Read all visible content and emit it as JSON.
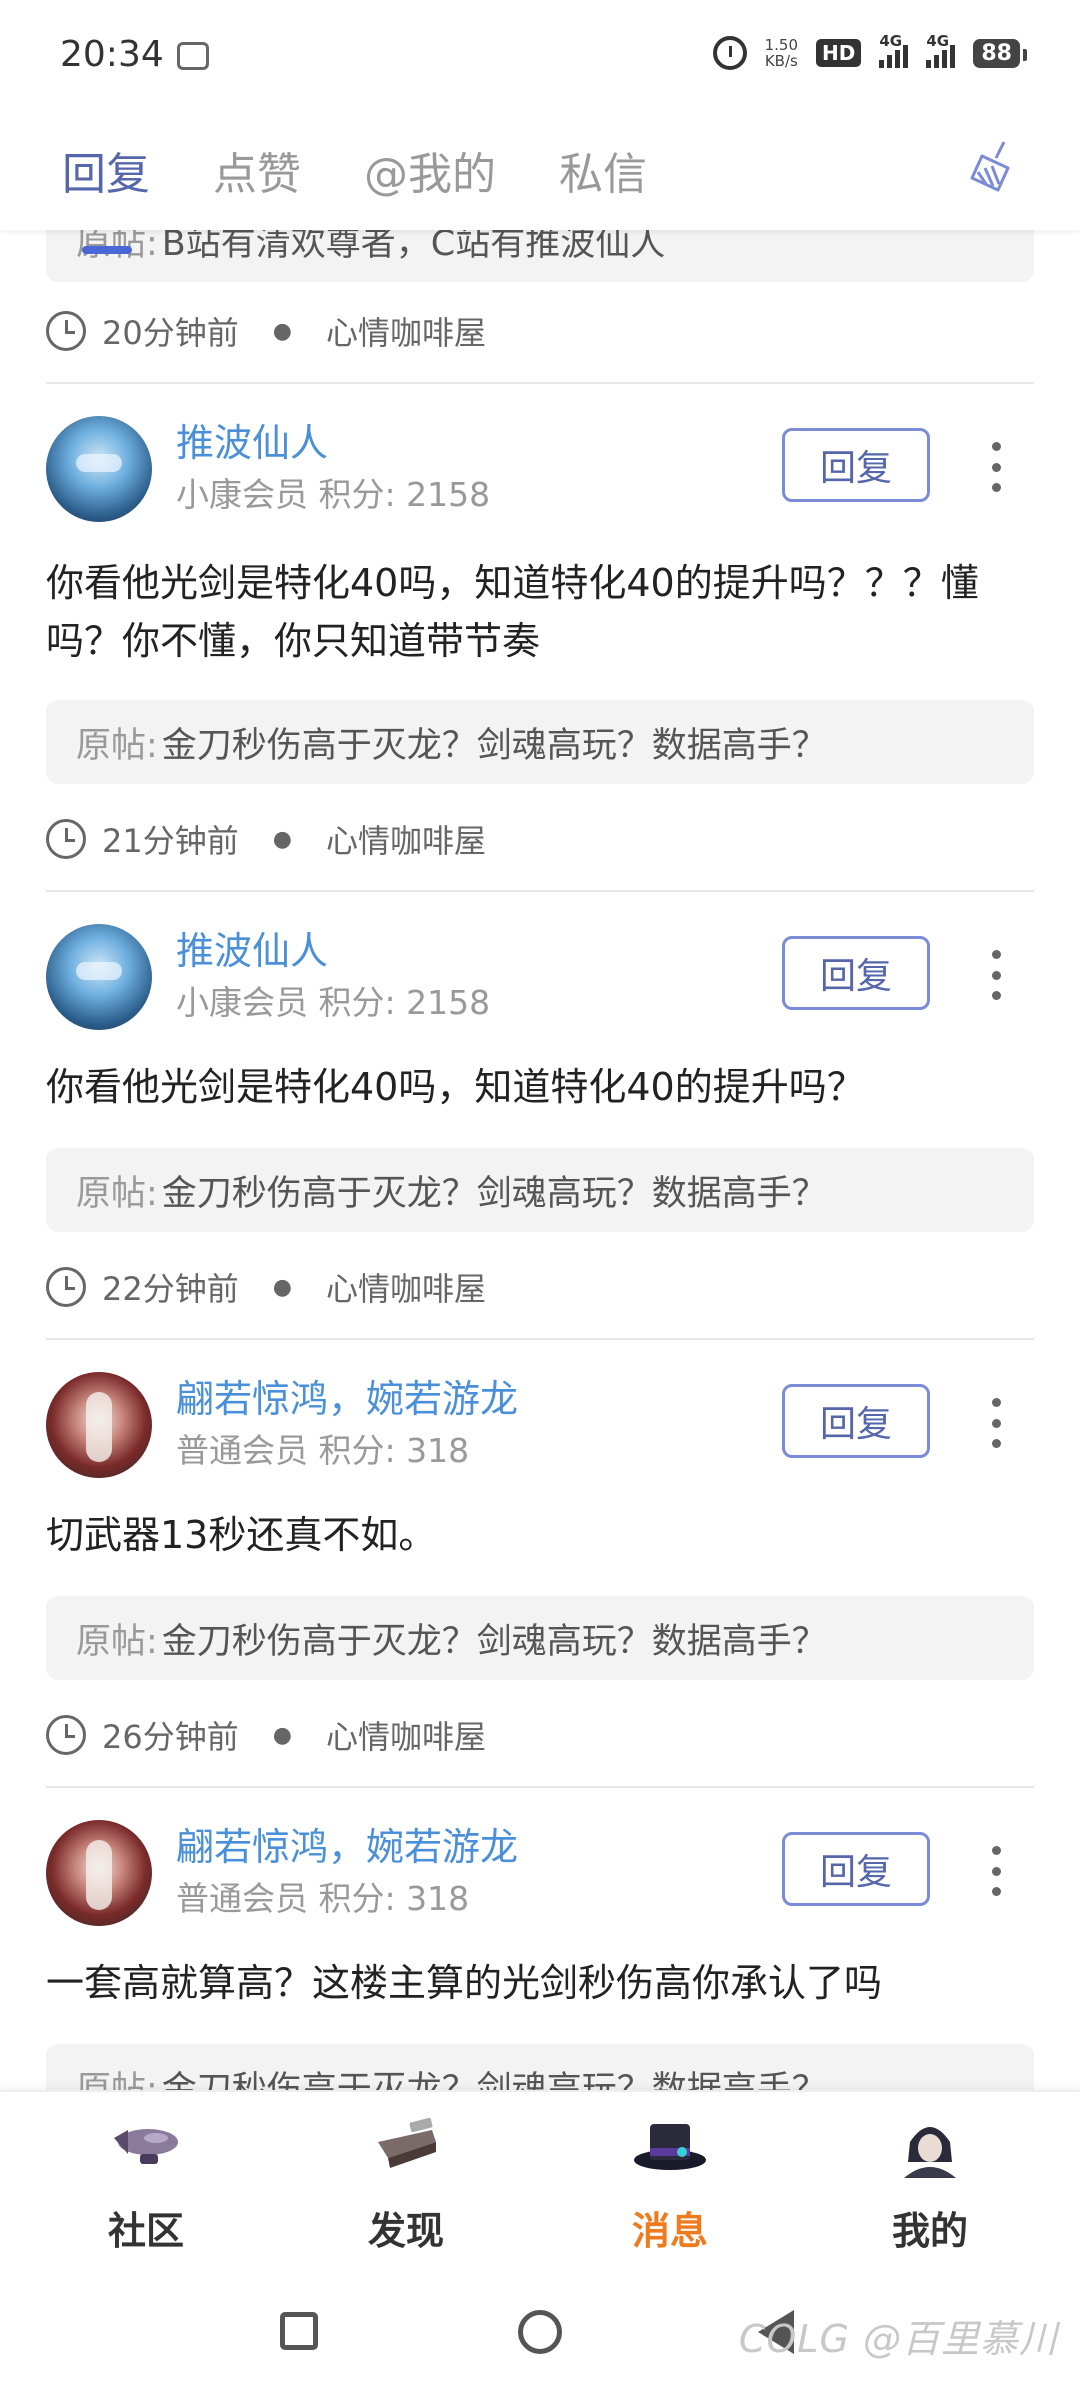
{
  "status_bar": {
    "time": "20:34",
    "net_speed_value": "1.50",
    "net_speed_unit": "KB/s",
    "hd": "HD",
    "signal1": "4G",
    "signal2": "4G",
    "battery": "88"
  },
  "tabs": [
    {
      "label": "回复",
      "active": true
    },
    {
      "label": "点赞",
      "active": false
    },
    {
      "label": "@我的",
      "active": false
    },
    {
      "label": "私信",
      "active": false
    }
  ],
  "feed": {
    "top_partial": {
      "quote_label": "原帖:",
      "quote_text": "B站有清欢尊者，C站有推波仙人",
      "time": "20分钟前",
      "board": "心情咖啡屋"
    },
    "items": [
      {
        "username": "推波仙人",
        "member": "小康会员",
        "score": "积分: 2158",
        "reply_label": "回复",
        "content": "你看他光剑是特化40吗，知道特化40的提升吗？？？懂吗？你不懂，你只知道带节奏",
        "quote_label": "原帖:",
        "quote_text": "金刀秒伤高于灭龙？剑魂高玩？数据高手？",
        "time": "21分钟前",
        "board": "心情咖啡屋"
      },
      {
        "username": "推波仙人",
        "member": "小康会员",
        "score": "积分: 2158",
        "reply_label": "回复",
        "content": "你看他光剑是特化40吗，知道特化40的提升吗？",
        "quote_label": "原帖:",
        "quote_text": "金刀秒伤高于灭龙？剑魂高玩？数据高手？",
        "time": "22分钟前",
        "board": "心情咖啡屋"
      },
      {
        "username": "翩若惊鸿，婉若游龙",
        "member": "普通会员",
        "score": "积分: 318",
        "reply_label": "回复",
        "content": "切武器13秒还真不如。",
        "quote_label": "原帖:",
        "quote_text": "金刀秒伤高于灭龙？剑魂高玩？数据高手？",
        "time": "26分钟前",
        "board": "心情咖啡屋"
      },
      {
        "username": "翩若惊鸿，婉若游龙",
        "member": "普通会员",
        "score": "积分: 318",
        "reply_label": "回复",
        "content": "一套高就算高？这楼主算的光剑秒伤高你承认了吗",
        "quote_label": "原帖:",
        "quote_text": "金刀秒伤高于灭龙？剑魂高玩？数据高手？"
      }
    ]
  },
  "bottom_nav": [
    {
      "label": "社区",
      "active": false
    },
    {
      "label": "发现",
      "active": false
    },
    {
      "label": "消息",
      "active": true
    },
    {
      "label": "我的",
      "active": false
    }
  ],
  "watermark": "COLG @百里慕川",
  "colors": {
    "accent": "#4a67d8",
    "username": "#4a90d9",
    "active_nav": "#f07a1e"
  }
}
